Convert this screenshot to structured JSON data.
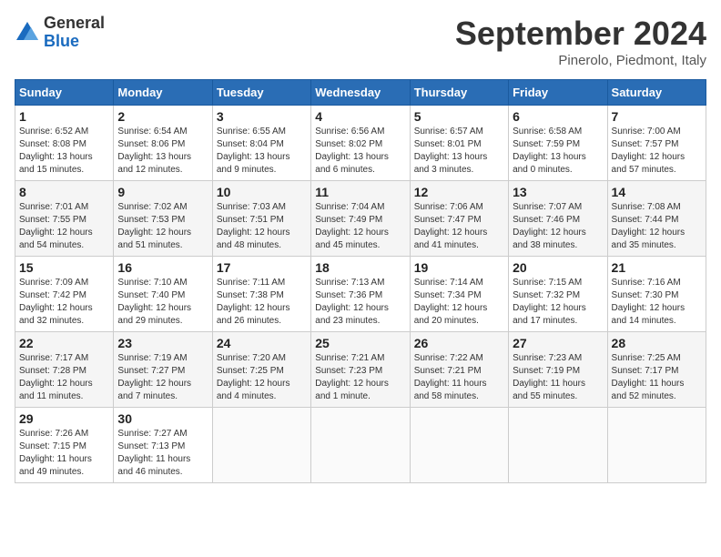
{
  "header": {
    "logo_general": "General",
    "logo_blue": "Blue",
    "month_title": "September 2024",
    "location": "Pinerolo, Piedmont, Italy"
  },
  "weekdays": [
    "Sunday",
    "Monday",
    "Tuesday",
    "Wednesday",
    "Thursday",
    "Friday",
    "Saturday"
  ],
  "weeks": [
    [
      {
        "day": "1",
        "info": "Sunrise: 6:52 AM\nSunset: 8:08 PM\nDaylight: 13 hours\nand 15 minutes."
      },
      {
        "day": "2",
        "info": "Sunrise: 6:54 AM\nSunset: 8:06 PM\nDaylight: 13 hours\nand 12 minutes."
      },
      {
        "day": "3",
        "info": "Sunrise: 6:55 AM\nSunset: 8:04 PM\nDaylight: 13 hours\nand 9 minutes."
      },
      {
        "day": "4",
        "info": "Sunrise: 6:56 AM\nSunset: 8:02 PM\nDaylight: 13 hours\nand 6 minutes."
      },
      {
        "day": "5",
        "info": "Sunrise: 6:57 AM\nSunset: 8:01 PM\nDaylight: 13 hours\nand 3 minutes."
      },
      {
        "day": "6",
        "info": "Sunrise: 6:58 AM\nSunset: 7:59 PM\nDaylight: 13 hours\nand 0 minutes."
      },
      {
        "day": "7",
        "info": "Sunrise: 7:00 AM\nSunset: 7:57 PM\nDaylight: 12 hours\nand 57 minutes."
      }
    ],
    [
      {
        "day": "8",
        "info": "Sunrise: 7:01 AM\nSunset: 7:55 PM\nDaylight: 12 hours\nand 54 minutes."
      },
      {
        "day": "9",
        "info": "Sunrise: 7:02 AM\nSunset: 7:53 PM\nDaylight: 12 hours\nand 51 minutes."
      },
      {
        "day": "10",
        "info": "Sunrise: 7:03 AM\nSunset: 7:51 PM\nDaylight: 12 hours\nand 48 minutes."
      },
      {
        "day": "11",
        "info": "Sunrise: 7:04 AM\nSunset: 7:49 PM\nDaylight: 12 hours\nand 45 minutes."
      },
      {
        "day": "12",
        "info": "Sunrise: 7:06 AM\nSunset: 7:47 PM\nDaylight: 12 hours\nand 41 minutes."
      },
      {
        "day": "13",
        "info": "Sunrise: 7:07 AM\nSunset: 7:46 PM\nDaylight: 12 hours\nand 38 minutes."
      },
      {
        "day": "14",
        "info": "Sunrise: 7:08 AM\nSunset: 7:44 PM\nDaylight: 12 hours\nand 35 minutes."
      }
    ],
    [
      {
        "day": "15",
        "info": "Sunrise: 7:09 AM\nSunset: 7:42 PM\nDaylight: 12 hours\nand 32 minutes."
      },
      {
        "day": "16",
        "info": "Sunrise: 7:10 AM\nSunset: 7:40 PM\nDaylight: 12 hours\nand 29 minutes."
      },
      {
        "day": "17",
        "info": "Sunrise: 7:11 AM\nSunset: 7:38 PM\nDaylight: 12 hours\nand 26 minutes."
      },
      {
        "day": "18",
        "info": "Sunrise: 7:13 AM\nSunset: 7:36 PM\nDaylight: 12 hours\nand 23 minutes."
      },
      {
        "day": "19",
        "info": "Sunrise: 7:14 AM\nSunset: 7:34 PM\nDaylight: 12 hours\nand 20 minutes."
      },
      {
        "day": "20",
        "info": "Sunrise: 7:15 AM\nSunset: 7:32 PM\nDaylight: 12 hours\nand 17 minutes."
      },
      {
        "day": "21",
        "info": "Sunrise: 7:16 AM\nSunset: 7:30 PM\nDaylight: 12 hours\nand 14 minutes."
      }
    ],
    [
      {
        "day": "22",
        "info": "Sunrise: 7:17 AM\nSunset: 7:28 PM\nDaylight: 12 hours\nand 11 minutes."
      },
      {
        "day": "23",
        "info": "Sunrise: 7:19 AM\nSunset: 7:27 PM\nDaylight: 12 hours\nand 7 minutes."
      },
      {
        "day": "24",
        "info": "Sunrise: 7:20 AM\nSunset: 7:25 PM\nDaylight: 12 hours\nand 4 minutes."
      },
      {
        "day": "25",
        "info": "Sunrise: 7:21 AM\nSunset: 7:23 PM\nDaylight: 12 hours\nand 1 minute."
      },
      {
        "day": "26",
        "info": "Sunrise: 7:22 AM\nSunset: 7:21 PM\nDaylight: 11 hours\nand 58 minutes."
      },
      {
        "day": "27",
        "info": "Sunrise: 7:23 AM\nSunset: 7:19 PM\nDaylight: 11 hours\nand 55 minutes."
      },
      {
        "day": "28",
        "info": "Sunrise: 7:25 AM\nSunset: 7:17 PM\nDaylight: 11 hours\nand 52 minutes."
      }
    ],
    [
      {
        "day": "29",
        "info": "Sunrise: 7:26 AM\nSunset: 7:15 PM\nDaylight: 11 hours\nand 49 minutes."
      },
      {
        "day": "30",
        "info": "Sunrise: 7:27 AM\nSunset: 7:13 PM\nDaylight: 11 hours\nand 46 minutes."
      },
      null,
      null,
      null,
      null,
      null
    ]
  ]
}
